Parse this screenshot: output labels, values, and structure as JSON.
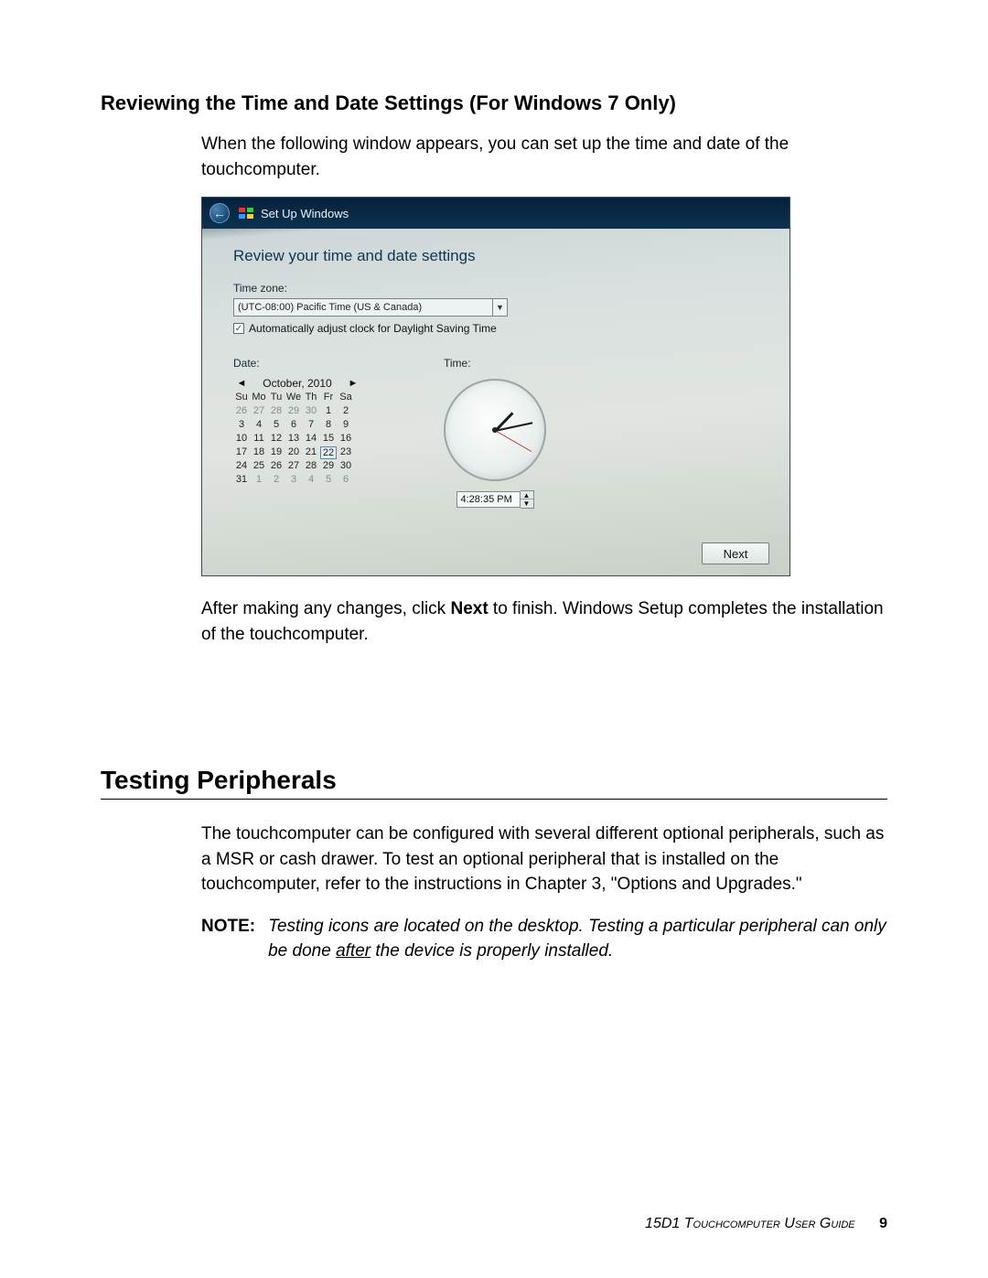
{
  "section1": {
    "heading": "Reviewing the Time and Date Settings (For Windows 7 Only)",
    "intro": "When the following window appears, you can set up the time and date of the touchcomputer.",
    "after_para_pre": "After making any changes, click ",
    "after_para_bold": "Next",
    "after_para_post": " to finish. Windows Setup completes the installation of the touchcomputer."
  },
  "screenshot": {
    "title": "Set Up Windows",
    "heading": "Review your time and date settings",
    "tz_label": "Time zone:",
    "tz_value": "(UTC-08:00) Pacific Time (US & Canada)",
    "dst_check": "Automatically adjust clock for Daylight Saving Time",
    "date_label": "Date:",
    "time_label": "Time:",
    "cal_month": "October, 2010",
    "cal_dow": [
      "Su",
      "Mo",
      "Tu",
      "We",
      "Th",
      "Fr",
      "Sa"
    ],
    "cal_rows": [
      [
        {
          "n": "26",
          "dim": true
        },
        {
          "n": "27",
          "dim": true
        },
        {
          "n": "28",
          "dim": true
        },
        {
          "n": "29",
          "dim": true
        },
        {
          "n": "30",
          "dim": true
        },
        {
          "n": "1"
        },
        {
          "n": "2"
        }
      ],
      [
        {
          "n": "3"
        },
        {
          "n": "4"
        },
        {
          "n": "5"
        },
        {
          "n": "6"
        },
        {
          "n": "7"
        },
        {
          "n": "8"
        },
        {
          "n": "9"
        }
      ],
      [
        {
          "n": "10"
        },
        {
          "n": "11"
        },
        {
          "n": "12"
        },
        {
          "n": "13"
        },
        {
          "n": "14"
        },
        {
          "n": "15"
        },
        {
          "n": "16"
        }
      ],
      [
        {
          "n": "17"
        },
        {
          "n": "18"
        },
        {
          "n": "19"
        },
        {
          "n": "20"
        },
        {
          "n": "21"
        },
        {
          "n": "22",
          "today": true
        },
        {
          "n": "23"
        }
      ],
      [
        {
          "n": "24"
        },
        {
          "n": "25"
        },
        {
          "n": "26"
        },
        {
          "n": "27"
        },
        {
          "n": "28"
        },
        {
          "n": "29"
        },
        {
          "n": "30"
        }
      ],
      [
        {
          "n": "31"
        },
        {
          "n": "1",
          "dim": true
        },
        {
          "n": "2",
          "dim": true
        },
        {
          "n": "3",
          "dim": true
        },
        {
          "n": "4",
          "dim": true
        },
        {
          "n": "5",
          "dim": true
        },
        {
          "n": "6",
          "dim": true
        }
      ]
    ],
    "time_value": "4:28:35 PM",
    "clock": {
      "hour_angle": 44,
      "min_angle": 78,
      "sec_angle": 120
    },
    "next": "Next"
  },
  "section2": {
    "heading": "Testing Peripherals",
    "para": "The touchcomputer can be configured with several different optional peripherals, such as a MSR or cash drawer. To test an optional peripheral that is installed on the touchcomputer, refer to the instructions in Chapter 3, \"Options and Upgrades.\"",
    "note_label": "NOTE:",
    "note_pre": "Testing icons are located on the desktop. Testing a particular peripheral can only be done ",
    "note_underline": "after",
    "note_post": " the device is properly installed."
  },
  "footer": {
    "text": "15D1 Touchcomputer User Guide",
    "page": "9"
  }
}
